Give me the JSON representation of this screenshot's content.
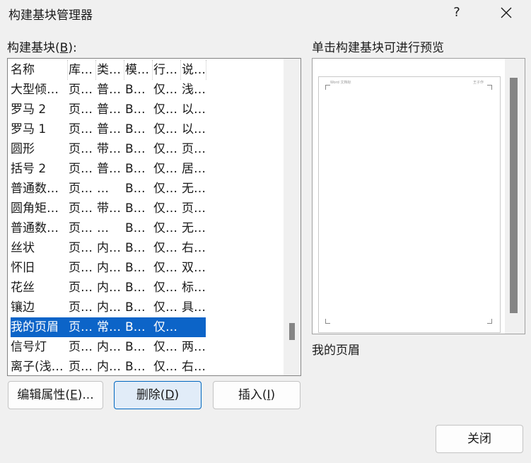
{
  "window": {
    "title": "构建基块管理器",
    "help": "?"
  },
  "list_label": {
    "text": "构建基块(",
    "key": "B",
    "end": "):"
  },
  "preview_label": "单击构建基块可进行预览",
  "columns": [
    "名称",
    "库…",
    "类…",
    "模…",
    "行…",
    "说…"
  ],
  "rows": [
    [
      "大型倾…",
      "页…",
      "普…",
      "B…",
      "仅…",
      "浅…"
    ],
    [
      "罗马 2",
      "页…",
      "普…",
      "B…",
      "仅…",
      "以…"
    ],
    [
      "罗马 1",
      "页…",
      "普…",
      "B…",
      "仅…",
      "以…"
    ],
    [
      "圆形",
      "页…",
      "带…",
      "B…",
      "仅…",
      "页…"
    ],
    [
      "括号 2",
      "页…",
      "普…",
      "B…",
      "仅…",
      "居…"
    ],
    [
      "普通数…",
      "页…",
      "…",
      "B…",
      "仅…",
      "无…"
    ],
    [
      "圆角矩…",
      "页…",
      "带…",
      "B…",
      "仅…",
      "页…"
    ],
    [
      "普通数…",
      "页…",
      "…",
      "B…",
      "仅…",
      "无…"
    ],
    [
      "丝状",
      "页…",
      "内…",
      "B…",
      "仅…",
      "右…"
    ],
    [
      "怀旧",
      "页…",
      "内…",
      "B…",
      "仅…",
      "双…"
    ],
    [
      "花丝",
      "页…",
      "内…",
      "B…",
      "仅…",
      "标…"
    ],
    [
      "镶边",
      "页…",
      "内…",
      "B…",
      "仅…",
      "具…"
    ],
    [
      "我的页眉",
      "页…",
      "常…",
      "B…",
      "仅…",
      ""
    ],
    [
      "信号灯",
      "页…",
      "内…",
      "B…",
      "仅…",
      "两…"
    ],
    [
      "离子(浅…",
      "页…",
      "内…",
      "B…",
      "仅…",
      "右…"
    ]
  ],
  "selected_index": 12,
  "preview": {
    "header_left": "Word 文档标",
    "header_right": "王子作",
    "name": "我的页眉"
  },
  "buttons": {
    "edit": {
      "text": "编辑属性(",
      "key": "E",
      "end": ")..."
    },
    "delete": {
      "text": "删除(",
      "key": "D",
      "end": ")"
    },
    "insert": {
      "text": "插入(",
      "key": "I",
      "end": ")"
    },
    "close": "关闭"
  },
  "colors": {
    "selection": "#0c64c8",
    "default_button_border": "#0067c0"
  },
  "icons": [
    "close-icon",
    "help-icon"
  ]
}
